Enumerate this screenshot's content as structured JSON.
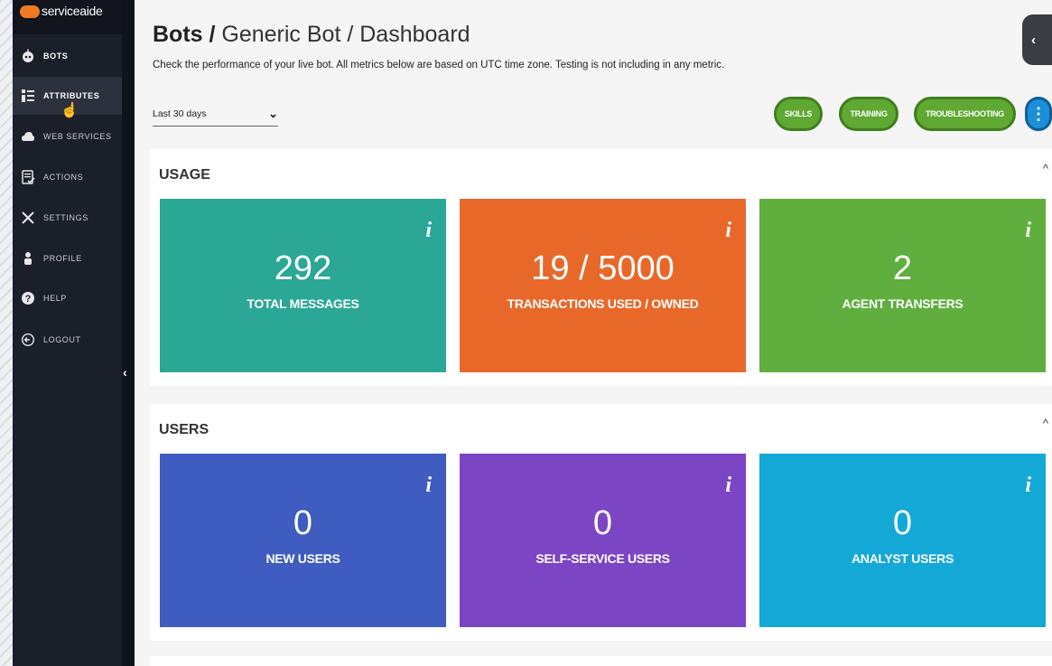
{
  "brand": {
    "name": "serviceaide"
  },
  "nav": {
    "items": [
      {
        "label": "BOTS",
        "icon": "bot-icon"
      },
      {
        "label": "ATTRIBUTES",
        "icon": "attributes-icon"
      },
      {
        "label": "WEB SERVICES",
        "icon": "cloud-icon"
      },
      {
        "label": "ACTIONS",
        "icon": "checklist-icon"
      },
      {
        "label": "SETTINGS",
        "icon": "tools-icon"
      },
      {
        "label": "PROFILE",
        "icon": "user-icon"
      },
      {
        "label": "HELP",
        "icon": "help-icon"
      },
      {
        "label": "LOGOUT",
        "icon": "logout-icon"
      }
    ],
    "collapse_glyph": "‹"
  },
  "header": {
    "title_bold": "Bots /",
    "title_rest": " Generic Bot / Dashboard",
    "subtitle": "Check the performance of your live bot. All metrics below are based on UTC time zone. Testing is not including in any metric.",
    "back_glyph": "‹"
  },
  "filter": {
    "range_value": "Last 30 days",
    "arrow_glyph": "⌄"
  },
  "actions": {
    "skills": "SKILLS",
    "training": "TRAINING",
    "troubleshooting": "TROUBLESHOOTING",
    "more_glyph": "⋮"
  },
  "usage": {
    "title": "USAGE",
    "cards": [
      {
        "value": "292",
        "label": "TOTAL MESSAGES",
        "color": "#2aa795"
      },
      {
        "value": "19 / 5000",
        "label": "TRANSACTIONS USED / OWNED",
        "color": "#e8682a"
      },
      {
        "value": "2",
        "label": "AGENT TRANSFERS",
        "color": "#5fae3e"
      }
    ]
  },
  "users": {
    "title": "USERS",
    "cards": [
      {
        "value": "0",
        "label": "NEW USERS",
        "color": "#3f5cc0"
      },
      {
        "value": "0",
        "label": "SELF-SERVICE USERS",
        "color": "#7b45c4"
      },
      {
        "value": "0",
        "label": "ANALYST USERS",
        "color": "#14a8d6"
      }
    ]
  },
  "info_glyph": "i",
  "collapse_glyph": "^",
  "colors": {
    "sidebar": "#1b1f2a",
    "accent_green": "#5fa832",
    "accent_blue": "#1c8fd6",
    "brand_orange": "#f07a22"
  }
}
